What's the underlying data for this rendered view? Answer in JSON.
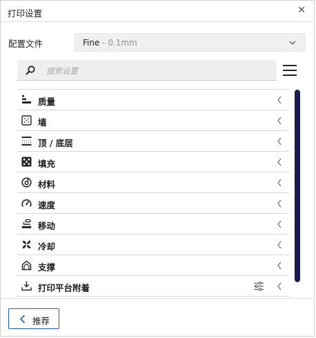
{
  "window": {
    "title": "打印设置"
  },
  "profile": {
    "label": "配置文件",
    "value": "Fine",
    "separator": " - ",
    "detail": "0.1mm"
  },
  "search": {
    "placeholder": "搜索设置"
  },
  "categories": [
    {
      "label": "质量",
      "icon": "quality-icon"
    },
    {
      "label": "墙",
      "icon": "wall-icon"
    },
    {
      "label": "顶 / 底层",
      "icon": "top-bottom-icon"
    },
    {
      "label": "填充",
      "icon": "infill-icon"
    },
    {
      "label": "材料",
      "icon": "material-icon"
    },
    {
      "label": "速度",
      "icon": "speed-icon"
    },
    {
      "label": "移动",
      "icon": "travel-icon"
    },
    {
      "label": "冷却",
      "icon": "cooling-icon"
    },
    {
      "label": "支撑",
      "icon": "support-icon"
    },
    {
      "label": "打印平台附着",
      "icon": "adhesion-icon"
    }
  ],
  "footer": {
    "recommended_label": "推荐"
  },
  "colors": {
    "accent": "#1a5fb4",
    "scrollbar": "#1a1a50"
  }
}
